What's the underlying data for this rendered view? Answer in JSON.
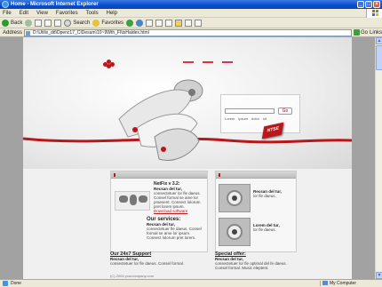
{
  "window": {
    "title": "Home - Microsoft Internet Explorer",
    "minimize": "_",
    "maximize": "□",
    "close": "×"
  },
  "menu": [
    "File",
    "Edit",
    "View",
    "Favorites",
    "Tools",
    "Help"
  ],
  "toolbar": {
    "back_label": "Back",
    "search_label": "Search",
    "favorites_label": "Favorites",
    "colors": {
      "back": "#2f9b2f",
      "forward": "#9fbf9f",
      "stop": "#d03a2a",
      "refresh": "#2f9b2f",
      "home": "#5a8ad6",
      "media": "#3f9e3f",
      "history": "#4d84c4",
      "mail": "#c7a349",
      "print": "#8a8a8a"
    }
  },
  "address": {
    "label": "Address",
    "url": "D:\\Utilix_dd\\Dpenc17_CIDesum\\10~9Wth_Fl\\tsHaidex.html",
    "go_label": "Go",
    "links_label": "Links"
  },
  "site": {
    "search_go": "Go",
    "search_links": [
      "Lorem",
      "ipsum",
      "dolor",
      "sit"
    ],
    "badge": "NTSE",
    "left_col": {
      "title": "NetFix v 3.2:",
      "intro_bold": "Recsan del tur,",
      "intro": "consectetuer lor fle daeus. Consel formal se ame lor praesent. Consect lolorum pret lorem ipsum.",
      "link": "Download software",
      "services_title": "Our services:",
      "services_bold": "Recsan del tur,",
      "services": "consectetuer fle daeus. Consel formal se ame lor ipsum. Consect lolorum pret lorem."
    },
    "right_col": {
      "item1_bold": "Recsan del tur,",
      "item1": "lor fle daeus.",
      "item2_bold": "Lorem del tur,",
      "item2": "lor fle daeus."
    },
    "bottom_left": {
      "title": "Our 24x7 Support",
      "bold": "Recsan del tur,",
      "text": "consectetuer lor fle daeus. Consel formal."
    },
    "bottom_right": {
      "title": "Special offer:",
      "bold": "Recsan del tur,",
      "text": "consectetuer lor fle optimal del fe daeus. Consel formal. Music eleptent."
    },
    "copyright": "(C) 2004 yourcompany.com",
    "accent_color": "#b8181c"
  },
  "status": {
    "left": "Done",
    "right": "My Computer"
  }
}
